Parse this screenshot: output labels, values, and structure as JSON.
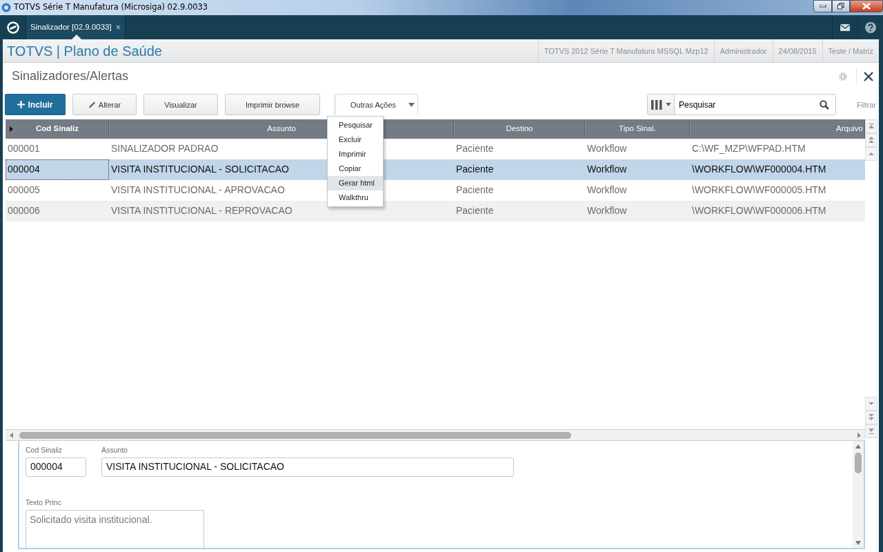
{
  "window": {
    "title": "TOTVS Série T Manufatura (Microsiga) 02.9.0033"
  },
  "tabs": [
    {
      "label": "Sinalizador [02.9.0033]",
      "close": "×",
      "selected": true
    }
  ],
  "app_header": {
    "title": "TOTVS | Plano de Saúde",
    "info": [
      "TOTVS 2012 Série T Manufatura MSSQL Mzp12",
      "Administrador",
      "24/08/2015",
      "Teste / Matriz"
    ]
  },
  "page_title": "Sinalizadores/Alertas",
  "toolbar": {
    "buttons": [
      {
        "label": "Incluir",
        "kind": "primary"
      },
      {
        "label": "Alterar",
        "kind": "edit"
      },
      {
        "label": "Visualizar",
        "kind": "plain"
      },
      {
        "label": "Imprimir browse",
        "kind": "plain"
      },
      {
        "label": "Outras Ações",
        "kind": "dropdown"
      }
    ],
    "menu": [
      {
        "label": "Pesquisar",
        "selected": false
      },
      {
        "label": "Excluir",
        "selected": false
      },
      {
        "label": "Imprimir",
        "selected": false
      },
      {
        "label": "Copiar",
        "selected": false
      },
      {
        "label": "Gerar html",
        "selected": true
      },
      {
        "label": "Walkthru",
        "selected": false
      }
    ],
    "search": {
      "value": "Pesquisar"
    },
    "filter": "Filtrar"
  },
  "table": {
    "columns": [
      "Cod Sinaliz",
      "Assunto",
      "Destino",
      "Tipo Sinal.",
      "Arquivo"
    ],
    "rows": [
      {
        "cells": [
          "000001",
          "SINALIZADOR PADRAO",
          "Paciente",
          "Workflow",
          "C:\\WF_MZP\\WFPAD.HTM"
        ],
        "selected": false
      },
      {
        "cells": [
          "000004",
          "VISITA INSTITUCIONAL - SOLICITACAO",
          "Paciente",
          "Workflow",
          "\\WORKFLOW\\WF000004.HTM"
        ],
        "selected": true
      },
      {
        "cells": [
          "000005",
          "VISITA INSTITUCIONAL - APROVACAO",
          "Paciente",
          "Workflow",
          "\\WORKFLOW\\WF000005.HTM"
        ],
        "selected": false
      },
      {
        "cells": [
          "000006",
          "VISITA INSTITUCIONAL - REPROVACAO",
          "Paciente",
          "Workflow",
          "\\WORKFLOW\\WF000006.HTM"
        ],
        "selected": false
      }
    ]
  },
  "detail": {
    "fields": [
      {
        "label": "Cod Sinaliz",
        "value": "000004",
        "kind": "short"
      },
      {
        "label": "Assunto",
        "value": "VISITA INSTITUCIONAL - SOLICITACAO",
        "kind": "long"
      },
      {
        "label": "Texto Princ",
        "value": "Solicitado visita institucional.",
        "kind": "memo"
      }
    ]
  }
}
